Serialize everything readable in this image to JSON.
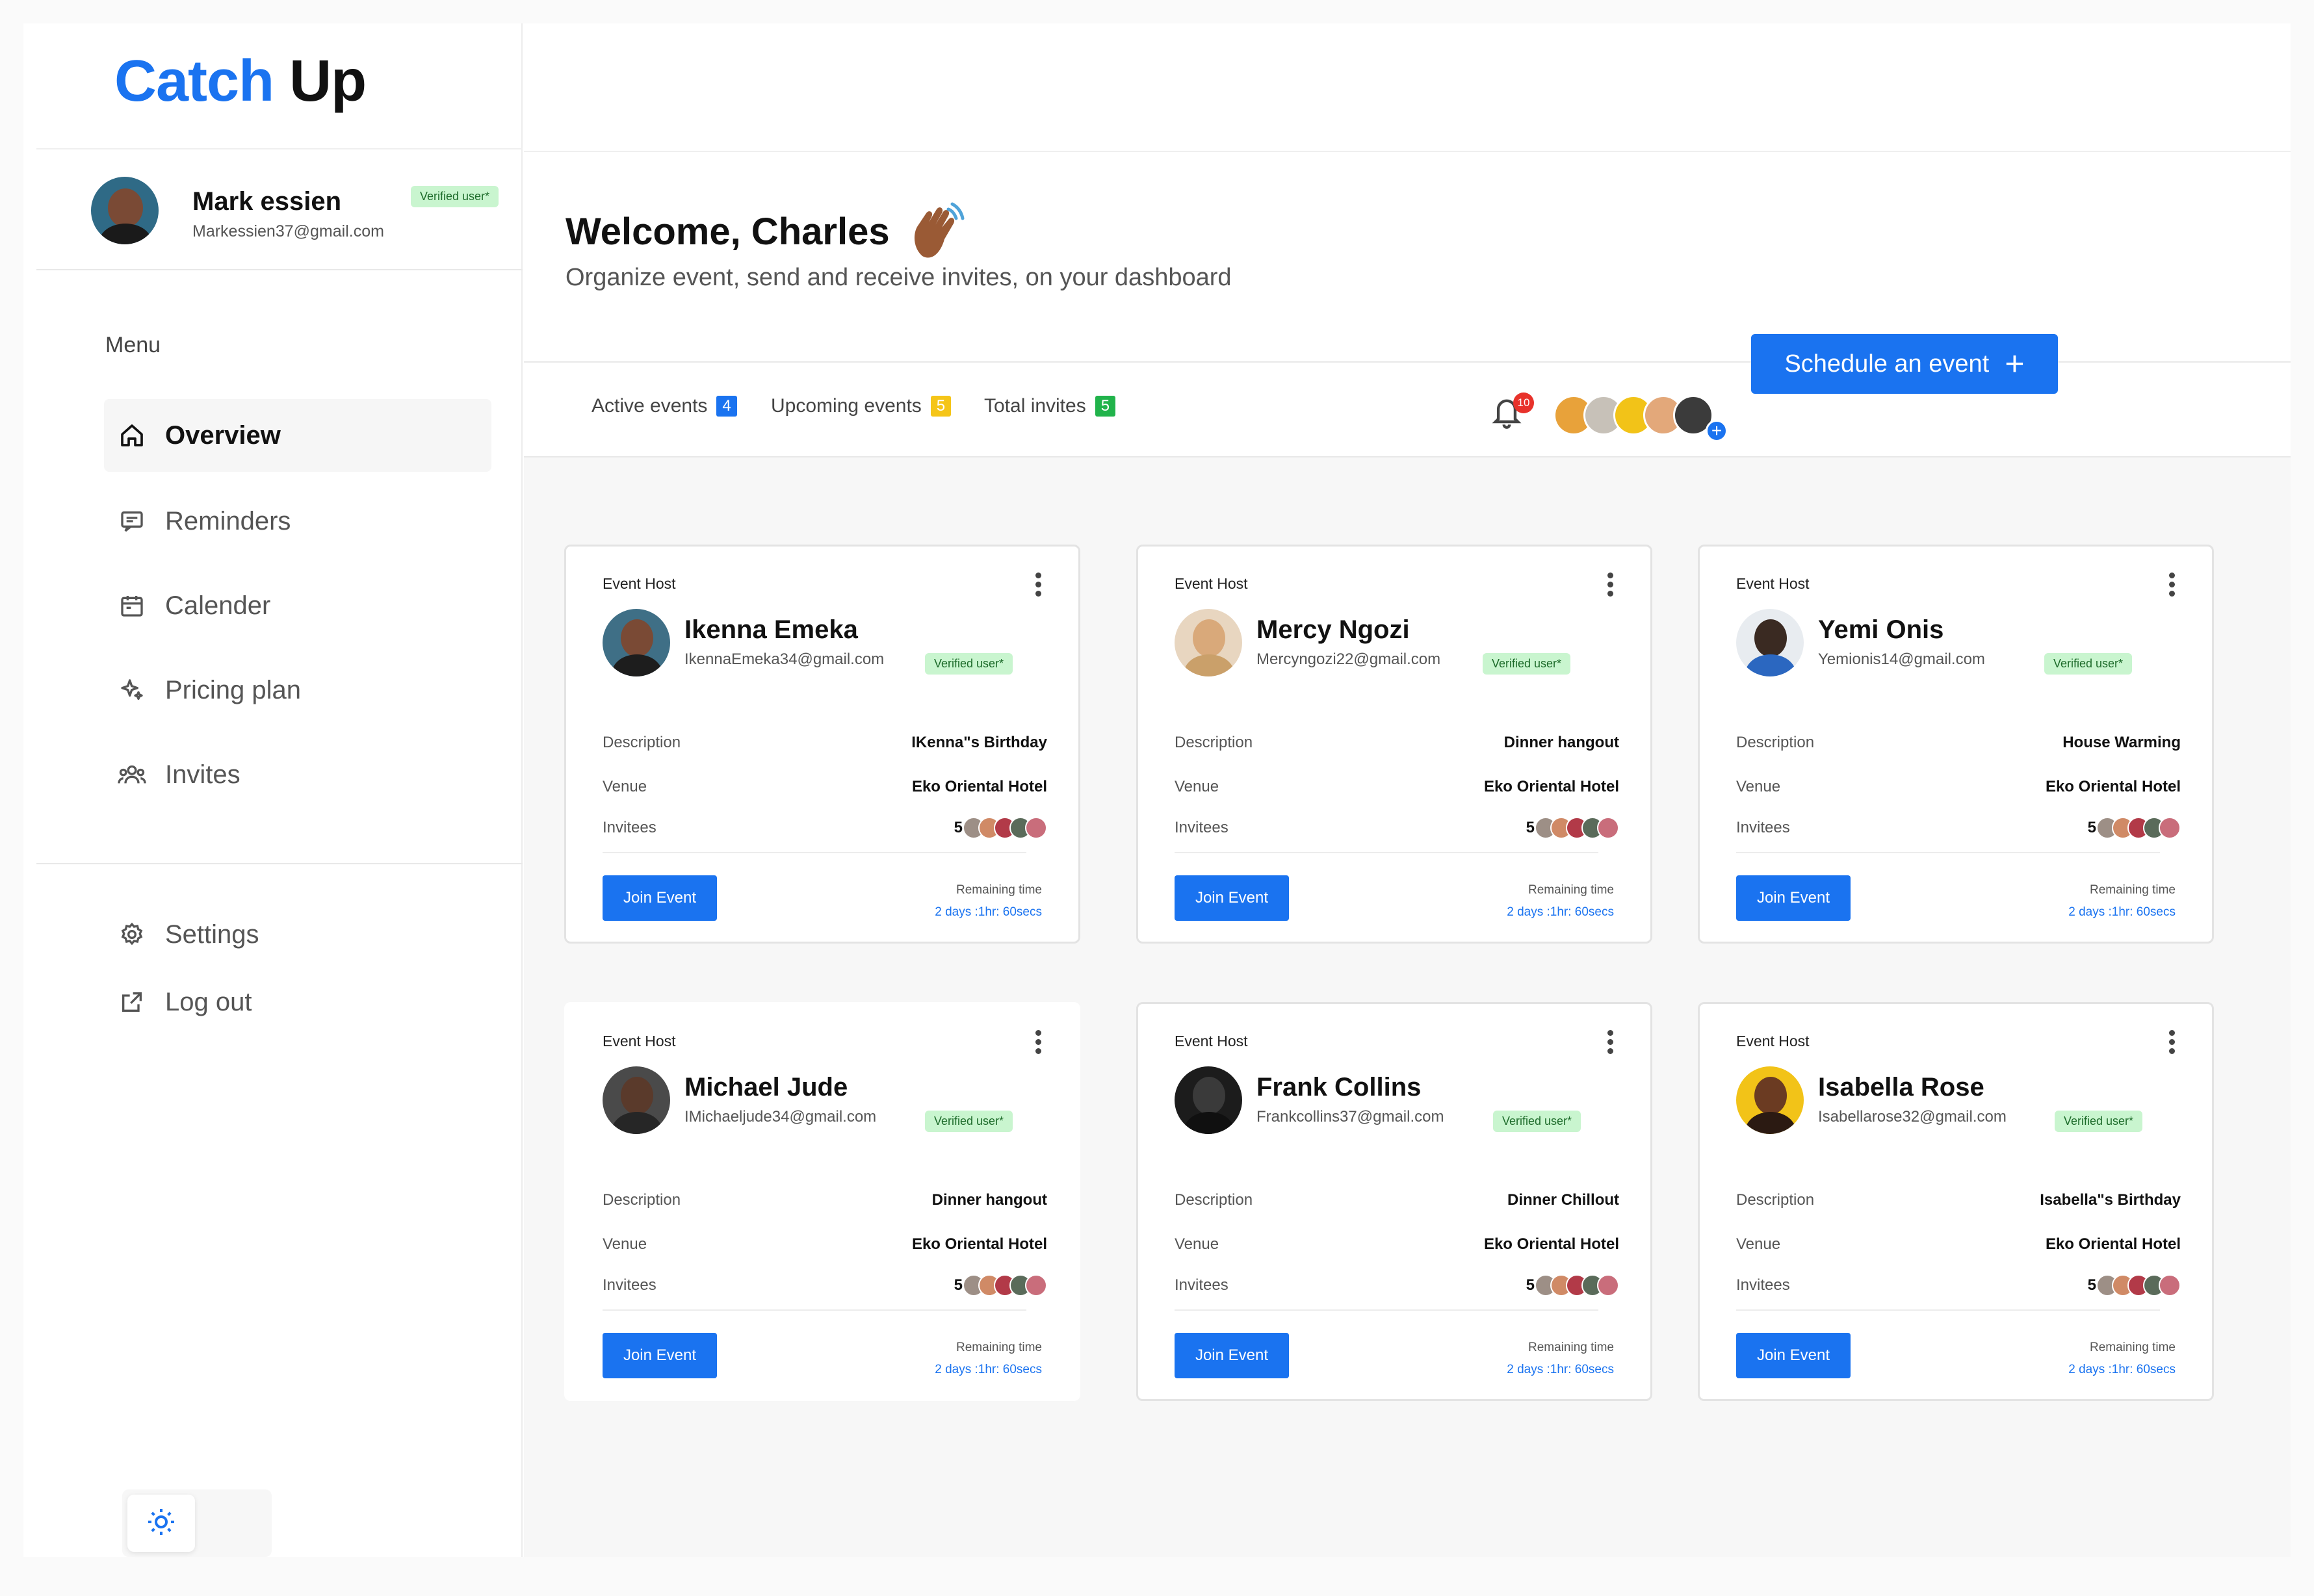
{
  "app": {
    "logo_part1": "Catch",
    "logo_part2": "Up"
  },
  "profile": {
    "name": "Mark essien",
    "email": "Markessien37@gmail.com",
    "badge": "Verified user*"
  },
  "sidebar": {
    "menu_label": "Menu",
    "items": [
      {
        "label": "Overview",
        "icon": "home-icon",
        "active": true
      },
      {
        "label": "Reminders",
        "icon": "message-icon",
        "active": false
      },
      {
        "label": "Calender",
        "icon": "calendar-icon",
        "active": false
      },
      {
        "label": "Pricing plan",
        "icon": "sparkle-icon",
        "active": false
      },
      {
        "label": "Invites",
        "icon": "people-icon",
        "active": false
      }
    ],
    "bottom_items": [
      {
        "label": "Settings",
        "icon": "gear-icon"
      },
      {
        "label": "Log out",
        "icon": "external-link-icon"
      }
    ],
    "theme_icon": "sun-icon"
  },
  "header": {
    "welcome": "Welcome, Charles",
    "wave_icon": "waving-hand-icon",
    "subtitle": "Organize event, send and receive invites, on your dashboard"
  },
  "tabs": [
    {
      "label": "Active events",
      "count": "4",
      "color": "#1a73f0"
    },
    {
      "label": "Upcoming events",
      "count": "5",
      "color": "#f5c518"
    },
    {
      "label": "Total invites",
      "count": "5",
      "color": "#21b34b"
    }
  ],
  "notifications": {
    "count": "10",
    "icon": "bell-icon"
  },
  "schedule_button": {
    "label": "Schedule an event",
    "icon": "plus-icon"
  },
  "card_labels": {
    "host": "Event Host",
    "description": "Description",
    "venue": "Venue",
    "invitees": "Invitees",
    "join": "Join Event",
    "remaining": "Remaining time"
  },
  "events": [
    {
      "host": "Ikenna Emeka",
      "email": "IkennaEmeka34@gmail.com",
      "badge": "Verified user*",
      "description": "IKenna\"s Birthday",
      "venue": "Eko Oriental Hotel",
      "invitees": "5",
      "remaining": "2 days :1hr: 60secs"
    },
    {
      "host": "Mercy Ngozi",
      "email": "Mercyngozi22@gmail.com",
      "badge": "Verified user*",
      "description": "Dinner hangout",
      "venue": "Eko Oriental Hotel",
      "invitees": "5",
      "remaining": "2 days :1hr: 60secs"
    },
    {
      "host": "Yemi Onis",
      "email": "Yemionis14@gmail.com",
      "badge": "Verified user*",
      "description": "House Warming",
      "venue": "Eko Oriental Hotel",
      "invitees": "5",
      "remaining": "2 days :1hr: 60secs"
    },
    {
      "host": "Michael Jude",
      "email": "IMichaeljude34@gmail.com",
      "badge": "Verified user*",
      "description": "Dinner hangout",
      "venue": "Eko Oriental Hotel",
      "invitees": "5",
      "remaining": "2 days :1hr: 60secs"
    },
    {
      "host": "Frank Collins",
      "email": "Frankcollins37@gmail.com",
      "badge": "Verified user*",
      "description": "Dinner Chillout",
      "venue": "Eko Oriental Hotel",
      "invitees": "5",
      "remaining": "2 days :1hr: 60secs"
    },
    {
      "host": "Isabella Rose",
      "email": "Isabellarose32@gmail.com",
      "badge": "Verified user*",
      "description": "Isabella\"s Birthday",
      "venue": "Eko Oriental Hotel",
      "invitees": "5",
      "remaining": "2 days :1hr: 60secs"
    }
  ]
}
